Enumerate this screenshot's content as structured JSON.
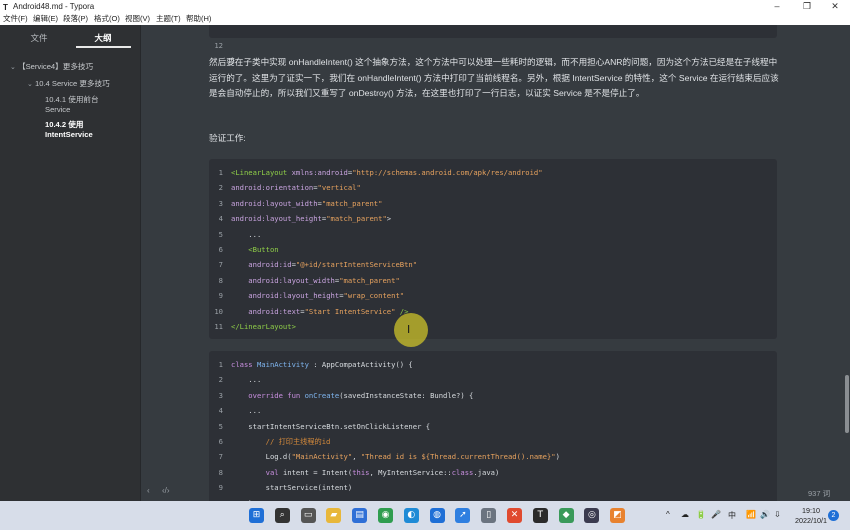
{
  "window": {
    "app_icon": "T",
    "title": "Android48.md - Typora",
    "minimize_glyph": "–",
    "maximize_glyph": "❐",
    "close_glyph": "✕"
  },
  "menu": [
    "文件(F)",
    "编辑(E)",
    "段落(P)",
    "格式(O)",
    "视图(V)",
    "主题(T)",
    "帮助(H)"
  ],
  "sidebar": {
    "tabs": [
      "文件",
      "大纲"
    ],
    "outline": [
      {
        "chevron": "⌄",
        "label": "【Service4】更多技巧"
      },
      {
        "chevron": "⌄",
        "label": "10.4 Service 更多技巧"
      },
      {
        "label": "10.4.1 使用前台"
      },
      {
        "label": "Service"
      },
      {
        "label": "10.4.2 使用"
      },
      {
        "label": "IntentService"
      }
    ],
    "bottom_left": "‹",
    "bottom_code": "‹/›"
  },
  "editor": {
    "top_block_line": {
      "num": "12",
      "text": "}"
    },
    "paragraph": "然后要在子类中实现 onHandleIntent() 这个抽象方法，这个方法中可以处理一些耗时的逻辑，而不用担心ANR的问题，因为这个方法已经是在子线程中运行的了。这里为了证实一下，我们在 onHandleIntent() 方法中打印了当前线程名。另外，根据 IntentService 的特性，这个 Service 在运行结束后应该是会自动停止的，所以我们又重写了 onDestroy() 方法，在这里也打印了一行日志，以证实 Service 是不是停止了。",
    "verify_label": "验证工作:",
    "xml_block": [
      {
        "num": "1",
        "parts": [
          [
            "tag",
            "<LinearLayout "
          ],
          [
            "attr",
            "xmlns:android"
          ],
          [
            "txt",
            "="
          ],
          [
            "str",
            "\"http://schemas.android.com/apk/res/android\""
          ]
        ]
      },
      {
        "num": "2",
        "parts": [
          [
            "attr",
            "android:orientation"
          ],
          [
            "txt",
            "="
          ],
          [
            "str",
            "\"vertical\""
          ]
        ]
      },
      {
        "num": "3",
        "parts": [
          [
            "attr",
            "android:layout_width"
          ],
          [
            "txt",
            "="
          ],
          [
            "str",
            "\"match_parent\""
          ]
        ]
      },
      {
        "num": "4",
        "parts": [
          [
            "attr",
            "android:layout_height"
          ],
          [
            "txt",
            "="
          ],
          [
            "str",
            "\"match_parent\""
          ],
          [
            "txt",
            ">"
          ]
        ]
      },
      {
        "num": "5",
        "parts": [
          [
            "txt",
            "    ..."
          ]
        ]
      },
      {
        "num": "6",
        "parts": [
          [
            "tag",
            "    <Button"
          ]
        ]
      },
      {
        "num": "7",
        "parts": [
          [
            "attr",
            "    android:id"
          ],
          [
            "txt",
            "="
          ],
          [
            "str",
            "\"@+id/startIntentServiceBtn\""
          ]
        ]
      },
      {
        "num": "8",
        "parts": [
          [
            "attr",
            "    android:layout_width"
          ],
          [
            "txt",
            "="
          ],
          [
            "str",
            "\"match_parent\""
          ]
        ]
      },
      {
        "num": "9",
        "parts": [
          [
            "attr",
            "    android:layout_height"
          ],
          [
            "txt",
            "="
          ],
          [
            "str",
            "\"wrap_content\""
          ]
        ]
      },
      {
        "num": "10",
        "parts": [
          [
            "attr",
            "    android:text"
          ],
          [
            "txt",
            "="
          ],
          [
            "str",
            "\"Start IntentService\""
          ],
          [
            "txt",
            " "
          ],
          [
            "tag",
            "/>"
          ]
        ]
      },
      {
        "num": "11",
        "parts": [
          [
            "tag",
            "</LinearLayout>"
          ]
        ]
      }
    ],
    "kotlin_block": [
      {
        "num": "1",
        "parts": [
          [
            "kw",
            "class "
          ],
          [
            "fn",
            "MainActivity"
          ],
          [
            "txt",
            " : AppCompatActivity() {"
          ]
        ]
      },
      {
        "num": "2",
        "parts": [
          [
            "txt",
            "    ..."
          ]
        ]
      },
      {
        "num": "3",
        "parts": [
          [
            "kw",
            "    override fun "
          ],
          [
            "fn",
            "onCreate"
          ],
          [
            "txt",
            "(savedInstanceState: Bundle?) {"
          ]
        ]
      },
      {
        "num": "4",
        "parts": [
          [
            "txt",
            "    ..."
          ]
        ]
      },
      {
        "num": "5",
        "parts": [
          [
            "txt",
            "    startIntentServiceBtn.setOnClickListener {"
          ]
        ]
      },
      {
        "num": "6",
        "parts": [
          [
            "cmt",
            "        // 打印主线程的id"
          ]
        ]
      },
      {
        "num": "7",
        "parts": [
          [
            "txt",
            "        Log.d("
          ],
          [
            "str",
            "\"MainActivity\""
          ],
          [
            "txt",
            ", "
          ],
          [
            "str",
            "\"Thread id is ${Thread.currentThread().name}\""
          ],
          [
            "txt",
            ")"
          ]
        ]
      },
      {
        "num": "8",
        "parts": [
          [
            "kw",
            "        val "
          ],
          [
            "txt",
            "intent = Intent("
          ],
          [
            "kw",
            "this"
          ],
          [
            "txt",
            ", MyIntentService::"
          ],
          [
            "kw",
            "class"
          ],
          [
            "txt",
            ".java)"
          ]
        ]
      },
      {
        "num": "9",
        "parts": [
          [
            "txt",
            "        startService(intent)"
          ]
        ]
      }
    ],
    "kotlin_partial_line": "    }"
  },
  "status": {
    "word_count": "937 词"
  },
  "taskbar": {
    "icons": [
      {
        "name": "windows-start-icon",
        "glyph": "⊞",
        "color": "#1f6fd6"
      },
      {
        "name": "search-icon",
        "glyph": "⌕",
        "color": "#333333"
      },
      {
        "name": "task-view-icon",
        "glyph": "▭",
        "color": "#555555"
      },
      {
        "name": "file-explorer-icon",
        "glyph": "▰",
        "color": "#e8b73a"
      },
      {
        "name": "store-icon",
        "glyph": "▤",
        "color": "#2f6fd6"
      },
      {
        "name": "chrome-icon",
        "glyph": "◉",
        "color": "#2f9d4f"
      },
      {
        "name": "edge-icon",
        "glyph": "◐",
        "color": "#1f8bd6"
      },
      {
        "name": "app-blue-icon",
        "glyph": "◍",
        "color": "#1f6fd6"
      },
      {
        "name": "app-arrow-icon",
        "glyph": "➚",
        "color": "#2f7fe0"
      },
      {
        "name": "recycle-bin-icon",
        "glyph": "▯",
        "color": "#6b7480"
      },
      {
        "name": "app-red-icon",
        "glyph": "✕",
        "color": "#e04a2f"
      },
      {
        "name": "typora-icon",
        "glyph": "T",
        "color": "#2b2b2b"
      },
      {
        "name": "app-green-icon",
        "glyph": "◆",
        "color": "#3a9a5a"
      },
      {
        "name": "app-dark-icon",
        "glyph": "◎",
        "color": "#3b3b4f"
      },
      {
        "name": "app-orange-icon",
        "glyph": "◩",
        "color": "#e8822f"
      }
    ],
    "tray": [
      "^",
      "☁",
      "🔋",
      "🎤",
      "中",
      "📶",
      "🔊",
      "⇩"
    ],
    "time": "19:10",
    "date": "2022/10/1",
    "notification_count": "2"
  }
}
